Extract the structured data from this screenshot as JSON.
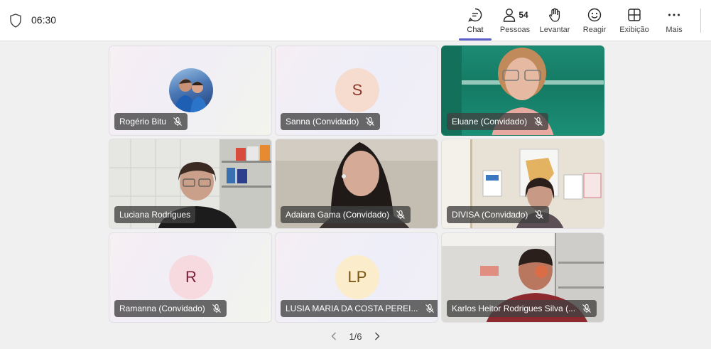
{
  "meeting": {
    "timer": "06:30"
  },
  "toolbar": {
    "chat": "Chat",
    "people": "Pessoas",
    "people_count": "54",
    "raise": "Levantar",
    "react": "Reagir",
    "view": "Exibição",
    "more": "Mais"
  },
  "participants": [
    {
      "name": "Rogério Bitu",
      "kind": "photo-avatar",
      "muted": true
    },
    {
      "name": "Sanna (Convidado)",
      "kind": "initials",
      "initials": "S",
      "avatar_bg": "#f6dccf",
      "avatar_fg": "#8a3a2a",
      "muted": true
    },
    {
      "name": "Eluane (Convidado)",
      "kind": "video",
      "muted": true
    },
    {
      "name": "Luciana Rodrigues",
      "kind": "video",
      "muted": false
    },
    {
      "name": "Adaiara Gama (Convidado)",
      "kind": "video",
      "muted": true
    },
    {
      "name": "DIVISA (Convidado)",
      "kind": "video",
      "muted": true
    },
    {
      "name": "Ramanna (Convidado)",
      "kind": "initials",
      "initials": "R",
      "avatar_bg": "#f7d9e0",
      "avatar_fg": "#7a1f3a",
      "muted": true
    },
    {
      "name": "LUSIA MARIA DA COSTA PEREI...",
      "kind": "initials",
      "initials": "LP",
      "avatar_bg": "#fbeccb",
      "avatar_fg": "#7a5410",
      "muted": true
    },
    {
      "name": "Karlos Heitor Rodrigues Silva (...",
      "kind": "video",
      "muted": true
    }
  ],
  "pagination": {
    "label": "1/6"
  }
}
